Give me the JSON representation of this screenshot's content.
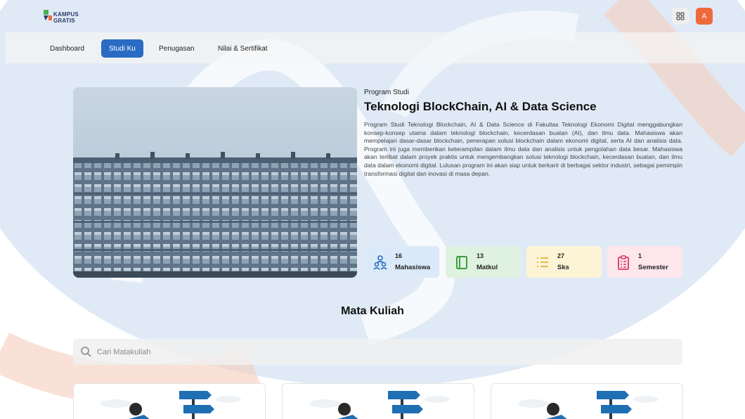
{
  "brand": {
    "logo_line1": "KAMPUS",
    "logo_line2": "GRATIS",
    "colors": {
      "blue": "#2a6cc4",
      "orange": "#ef6a3a",
      "green": "#4caf50"
    }
  },
  "header": {
    "apps_icon": "grid-icon",
    "avatar_initial": "A"
  },
  "nav": {
    "items": [
      {
        "label": "Dashboard",
        "active": false
      },
      {
        "label": "Studi Ku",
        "active": true
      },
      {
        "label": "Penugasan",
        "active": false
      },
      {
        "label": "Nilai & Sertifikat",
        "active": false
      }
    ]
  },
  "program": {
    "label": "Program Studi",
    "title": "Teknologi BlockChain, AI & Data Science",
    "description": "Program Studi Teknologi Blockchain, AI & Data Science di Fakultas Teknologi Ekonomi Digital menggabungkan konsep-konsep utama dalam teknologi blockchain, kecerdasan buatan (AI), dan ilmu data. Mahasiswa akan mempelajari dasar-dasar blockchain, penerapan solusi blockchain dalam ekonomi digital, serta AI dan analisis data. Program ini juga memberikan keterampilan dalam ilmu data dan analisis untuk pengolahan data besar. Mahasiswa akan terlibat dalam proyek praktis untuk mengembangkan solusi teknologi blockchain, kecerdasan buatan, dan ilmu data dalam ekonomi digital. Lulusan program ini akan siap untuk berkarir di berbagai sektor industri, sebagai pemimpin transformasi digital dan inovasi di masa depan.",
    "stats": [
      {
        "value": "16",
        "label": "Mahasiswa",
        "icon": "students-icon",
        "bg": "#dbe9f8",
        "color": "#2a6cc4"
      },
      {
        "value": "13",
        "label": "Matkul",
        "icon": "book-icon",
        "bg": "#dff2df",
        "color": "#3f9b45"
      },
      {
        "value": "27",
        "label": "Sks",
        "icon": "list-icon",
        "bg": "#fdf4d6",
        "color": "#e0b43a"
      },
      {
        "value": "1",
        "label": "Semester",
        "icon": "clipboard-icon",
        "bg": "#fde6ec",
        "color": "#d63a6a"
      }
    ]
  },
  "courses": {
    "title": "Mata Kuliah",
    "search_placeholder": "Cari Matakuliah",
    "cards": [
      {
        "illustration": "signpost-illustration"
      },
      {
        "illustration": "signpost-illustration"
      },
      {
        "illustration": "signpost-illustration"
      }
    ]
  }
}
